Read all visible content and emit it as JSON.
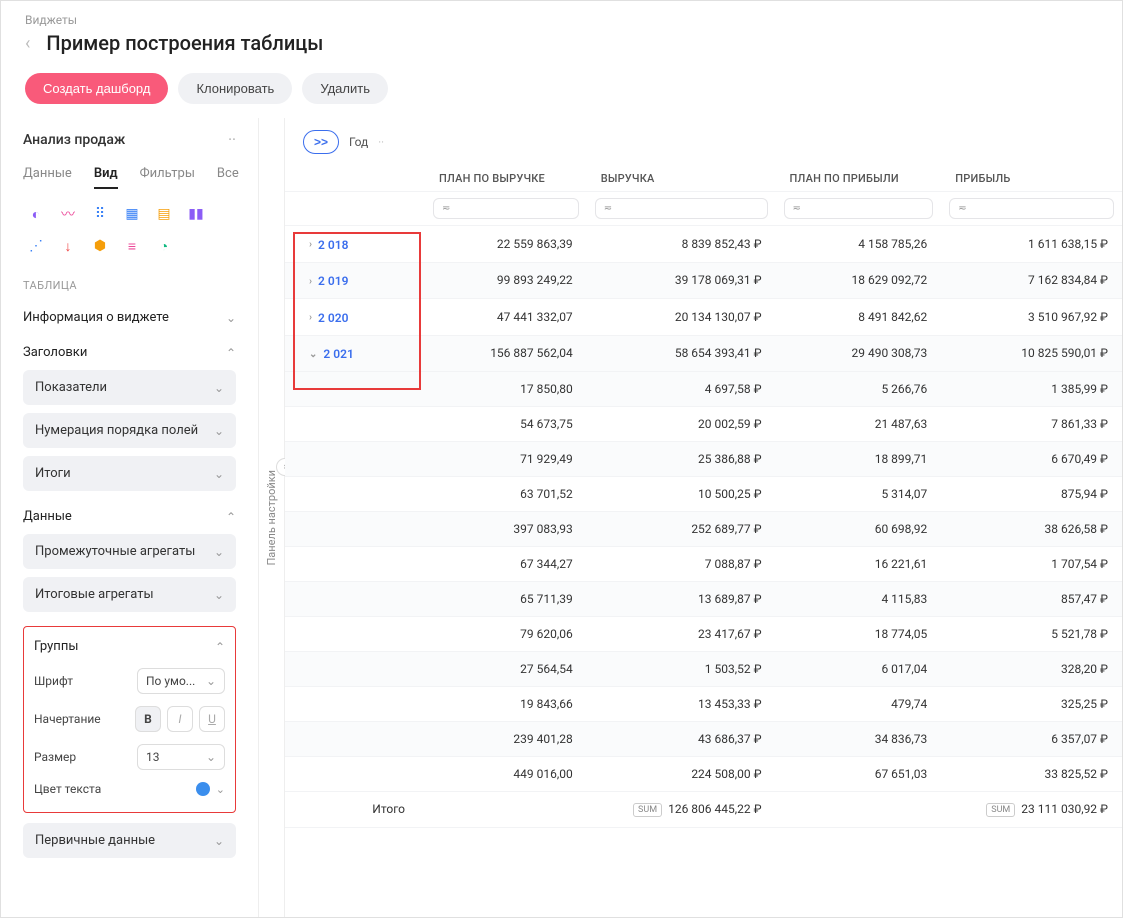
{
  "breadcrumb": "Виджеты",
  "page_title": "Пример построения таблицы",
  "actions": {
    "create": "Создать дашборд",
    "clone": "Клонировать",
    "delete": "Удалить"
  },
  "sidebar": {
    "title": "Анализ продаж",
    "tabs": {
      "data": "Данные",
      "view": "Вид",
      "filters": "Фильтры",
      "all": "Все"
    },
    "section_label": "ТАБЛИЦА",
    "widget_info": "Информация о виджете",
    "headers_label": "Заголовки",
    "headers_items": {
      "indicators": "Показатели",
      "field_order": "Нумерация порядка полей",
      "totals": "Итоги"
    },
    "data_label": "Данные",
    "data_items": {
      "sub_agg": "Промежуточные агрегаты",
      "final_agg": "Итоговые агрегаты"
    },
    "groups": {
      "label": "Группы",
      "font_label": "Шрифт",
      "font_value": "По умо...",
      "style_label": "Начертание",
      "size_label": "Размер",
      "size_value": "13",
      "color_label": "Цвет текста"
    },
    "primary_data": "Первичные данные"
  },
  "panel_label": "Панель настройки",
  "content": {
    "expand": ">>",
    "dimension": "Год",
    "columns": {
      "plan_revenue": "ПЛАН ПО ВЫРУЧКЕ",
      "revenue": "ВЫРУЧКА",
      "plan_profit": "ПЛАН ПО ПРИБЫЛИ",
      "profit": "ПРИБЫЛЬ"
    },
    "years": [
      {
        "label": "2 018",
        "expanded": false,
        "plan_revenue": "22 559 863,39",
        "revenue": "8 839 852,43 ₽",
        "plan_profit": "4 158 785,26",
        "profit": "1 611 638,15 ₽"
      },
      {
        "label": "2 019",
        "expanded": false,
        "plan_revenue": "99 893 249,22",
        "revenue": "39 178 069,31 ₽",
        "plan_profit": "18 629 092,72",
        "profit": "7 162 834,84 ₽"
      },
      {
        "label": "2 020",
        "expanded": false,
        "plan_revenue": "47 441 332,07",
        "revenue": "20 134 130,07 ₽",
        "plan_profit": "8 491 842,62",
        "profit": "3 510 967,92 ₽"
      },
      {
        "label": "2 021",
        "expanded": true,
        "plan_revenue": "156 887 562,04",
        "revenue": "58 654 393,41 ₽",
        "plan_profit": "29 490 308,73",
        "profit": "10 825 590,01 ₽"
      }
    ],
    "detail_rows": [
      {
        "plan_revenue": "17 850,80",
        "revenue": "4 697,58 ₽",
        "plan_profit": "5 266,76",
        "profit": "1 385,99 ₽"
      },
      {
        "plan_revenue": "54 673,75",
        "revenue": "20 002,59 ₽",
        "plan_profit": "21 487,63",
        "profit": "7 861,33 ₽"
      },
      {
        "plan_revenue": "71 929,49",
        "revenue": "25 386,88 ₽",
        "plan_profit": "18 899,71",
        "profit": "6 670,49 ₽"
      },
      {
        "plan_revenue": "63 701,52",
        "revenue": "10 500,25 ₽",
        "plan_profit": "5 314,07",
        "profit": "875,94 ₽"
      },
      {
        "plan_revenue": "397 083,93",
        "revenue": "252 689,77 ₽",
        "plan_profit": "60 698,92",
        "profit": "38 626,58 ₽"
      },
      {
        "plan_revenue": "67 344,27",
        "revenue": "7 088,87 ₽",
        "plan_profit": "16 221,61",
        "profit": "1 707,54 ₽"
      },
      {
        "plan_revenue": "65 711,39",
        "revenue": "13 689,87 ₽",
        "plan_profit": "4 115,83",
        "profit": "857,47 ₽"
      },
      {
        "plan_revenue": "79 620,06",
        "revenue": "23 417,67 ₽",
        "plan_profit": "18 774,05",
        "profit": "5 521,78 ₽"
      },
      {
        "plan_revenue": "27 564,54",
        "revenue": "1 503,52 ₽",
        "plan_profit": "6 017,04",
        "profit": "328,20 ₽"
      },
      {
        "plan_revenue": "19 843,66",
        "revenue": "13 453,33 ₽",
        "plan_profit": "479,74",
        "profit": "325,25 ₽"
      },
      {
        "plan_revenue": "239 401,28",
        "revenue": "43 686,37 ₽",
        "plan_profit": "34 836,73",
        "profit": "6 357,07 ₽"
      },
      {
        "plan_revenue": "449 016,00",
        "revenue": "224 508,00 ₽",
        "plan_profit": "67 651,03",
        "profit": "33 825,52 ₽"
      }
    ],
    "footer": {
      "label": "Итого",
      "sum_badge": "SUM",
      "revenue": "126 806 445,22 ₽",
      "profit": "23 111 030,92 ₽"
    }
  }
}
